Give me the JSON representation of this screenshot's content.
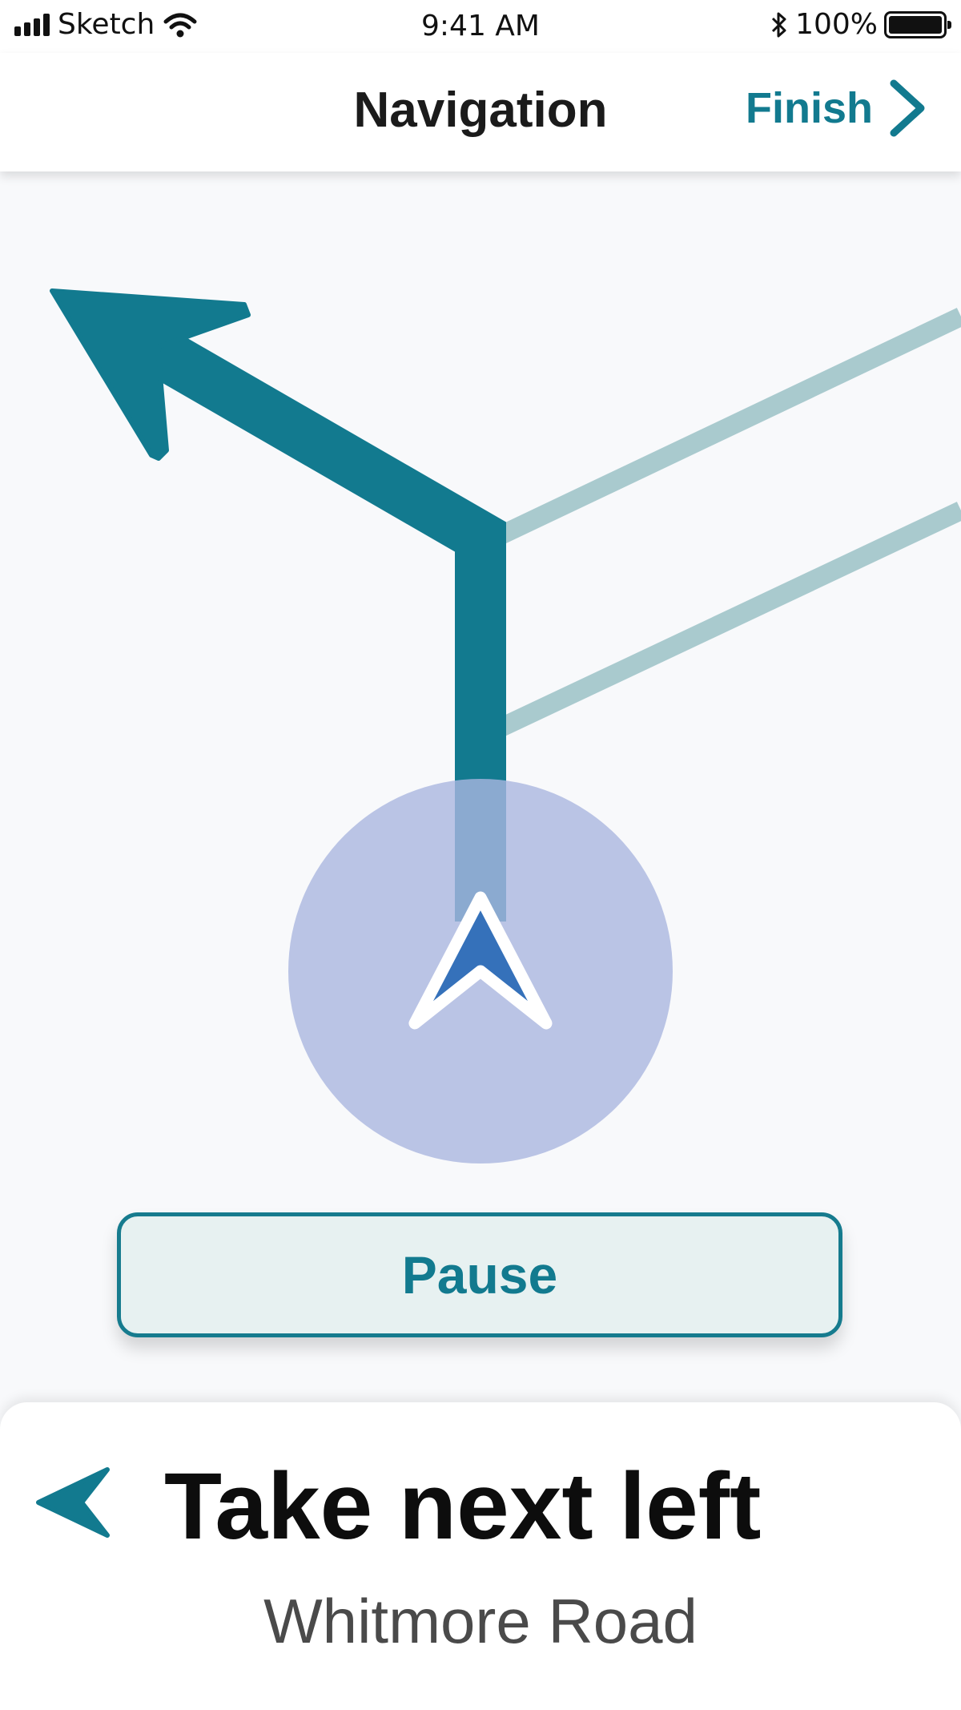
{
  "status_bar": {
    "carrier": "Sketch",
    "time": "9:41 AM",
    "battery": "100%"
  },
  "header": {
    "title": "Navigation",
    "finish_label": "Finish"
  },
  "map": {
    "route_color": "#127a8f",
    "side_road_color": "#a9cace",
    "location_halo_color": "#b8c4e6",
    "location_arrow_color": "#3571ba"
  },
  "pause_button": {
    "label": "Pause"
  },
  "direction": {
    "instruction": "Take next left",
    "street": "Whitmore Road",
    "turn_icon": "chevron-left-icon"
  }
}
